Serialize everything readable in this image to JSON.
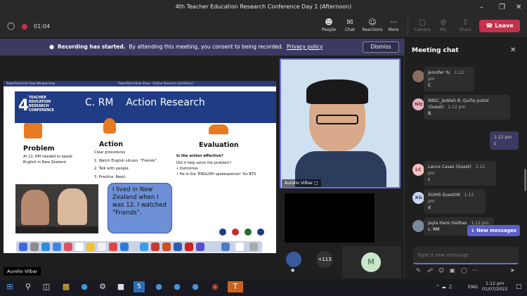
{
  "window": {
    "title": "4th Teacher Education Research Conference Day 1 (Afternoon)"
  },
  "toolbar": {
    "timer": "01:04",
    "people": "People",
    "chat": "Chat",
    "reactions": "Reactions",
    "more": "More",
    "camera": "Camera",
    "mic": "Mic",
    "share": "Share",
    "leave": "Leave"
  },
  "banner": {
    "bold": "Recording has started.",
    "text": "By attending this meeting, you consent to being recorded.",
    "link": "Privacy policy",
    "dismiss": "Dismiss"
  },
  "slide": {
    "org_lines": [
      "TEACHER",
      "EDUCATION",
      "RESEARCH",
      "CONFERENCE"
    ],
    "org_num": "4",
    "title": "C. RM    Action Research",
    "col1_title": "Problem",
    "col1_text": [
      "At 12, RM needed to speak",
      "English in New Zealand"
    ],
    "col2_title": "Action",
    "col2_text": [
      "Clear procedures",
      "1. Watch English sitcom, “Friends”.",
      "2. Talk with people.",
      "3. Practice. Read."
    ],
    "col3_title": "Evaluation",
    "col3_q": "Is the action effective?",
    "col3_text": [
      "Did it help solve the problem?",
      "• Outcomes",
      "• He is the ‘ENGLISH spokesperson’ for BTS"
    ],
    "bubble": "I lived in New Zealand when I was 12.  I watched “Friends”.",
    "mac_menu": "PowerPoint  Edit  View  Window  Help",
    "mac_title": "PowerPoint Slide Show - [Action Research and Ethics]"
  },
  "participant": {
    "name": "Aurelio Vilbar"
  },
  "presenter": {
    "name": "Aurelio Vilbar"
  },
  "overflow": {
    "count": "+113",
    "letter": "M"
  },
  "chat": {
    "title": "Meeting chat",
    "messages": [
      {
        "name": "Jennifer Yu",
        "time": "1:12 pm",
        "text": "C",
        "initials": "",
        "color": "#8a6d5a"
      },
      {
        "name": "NBSC_Jeddah B. Quiño-Justol (Guest)",
        "time": "1:12 pm",
        "text": "B.",
        "initials": "NQ",
        "color": "#e8b4c0"
      },
      {
        "name": "",
        "time": "1:12 pm",
        "text": "c",
        "initials": "",
        "color": ""
      },
      {
        "name": "Lance Casas (Guest)",
        "time": "1:12 pm",
        "text": "c",
        "initials": "LC",
        "color": "#f3c4c4"
      },
      {
        "name": "XUIHS Guest06",
        "time": "1:12 pm",
        "text": "d",
        "initials": "XG",
        "color": "#c8d6f0"
      },
      {
        "name": "Jayla Hans Halibas",
        "time": "1:12 pm",
        "text": "c. RM",
        "initials": "",
        "color": "#7a8a9a"
      }
    ],
    "new_messages": "New messages",
    "placeholder": "Type a new message"
  },
  "taskbar": {
    "lang": "ENG",
    "time": "1:12 pm",
    "date": "01/07/2022"
  }
}
